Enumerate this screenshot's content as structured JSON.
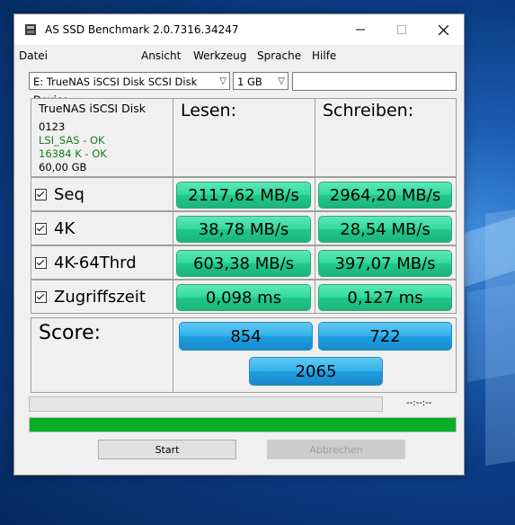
{
  "window": {
    "title": "AS SSD Benchmark 2.0.7316.34247"
  },
  "menu": [
    "Datei",
    "Ansicht",
    "Werkzeug",
    "Sprache",
    "Hilfe"
  ],
  "toolbar": {
    "drive_select": "E: TrueNAS iSCSI Disk SCSI Disk Device",
    "size_select": "1 GB",
    "filter_value": ""
  },
  "drive_info": {
    "name": "TrueNAS iSCSI Disk",
    "firmware": "0123",
    "driver_status": "LSI_SAS - OK",
    "alignment_status": "16384 K - OK",
    "capacity": "60,00 GB"
  },
  "columns": {
    "read": "Lesen:",
    "write": "Schreiben:"
  },
  "tests": [
    {
      "label": "Seq",
      "read": "2117,62 MB/s",
      "write": "2964,20 MB/s"
    },
    {
      "label": "4K",
      "read": "38,78 MB/s",
      "write": "28,54 MB/s"
    },
    {
      "label": "4K-64Thrd",
      "read": "603,38 MB/s",
      "write": "397,07 MB/s"
    },
    {
      "label": "Zugriffszeit",
      "read": "0,098 ms",
      "write": "0,127 ms"
    }
  ],
  "score": {
    "label": "Score:",
    "read": "854",
    "write": "722",
    "total": "2065"
  },
  "progress": {
    "time": "--:--:--",
    "upper_fill": 0,
    "lower_fill": 1
  },
  "buttons": {
    "start": "Start",
    "abort": "Abbrechen"
  },
  "colors": {
    "value_green": "#2fd99a",
    "score_blue": "#2fb1ea",
    "progress_green": "#06b025"
  }
}
